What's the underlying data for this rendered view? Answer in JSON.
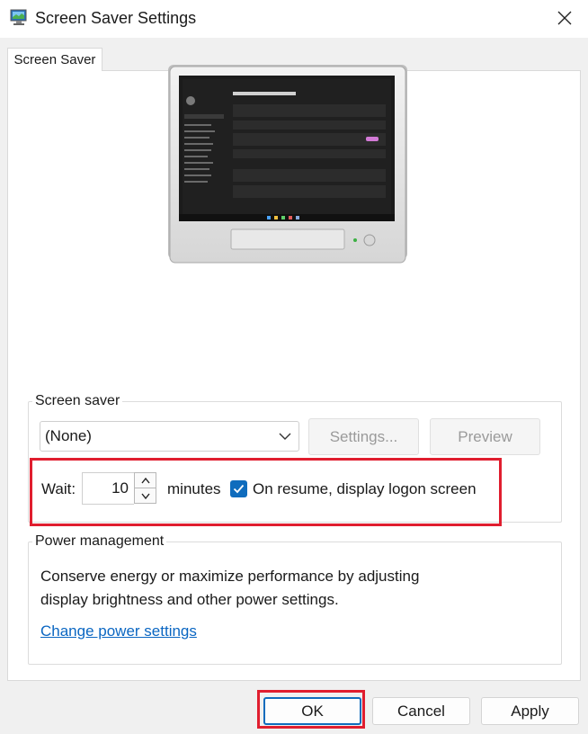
{
  "window": {
    "title": "Screen Saver Settings",
    "app_icon": "monitor-icon",
    "close_icon": "close-icon"
  },
  "tabs": [
    {
      "label": "Screen Saver"
    }
  ],
  "screen_saver": {
    "group_label": "Screen saver",
    "selected": "(None)",
    "settings_label": "Settings...",
    "preview_label": "Preview",
    "wait_label": "Wait:",
    "wait_value": "10",
    "minutes_label": "minutes",
    "resume_checkbox_label": "On resume, display logon screen",
    "resume_checked": true
  },
  "power": {
    "group_label": "Power management",
    "description_line1": "Conserve energy or maximize performance by adjusting",
    "description_line2": "display brightness and other power settings.",
    "link_label": "Change power settings"
  },
  "footer": {
    "ok_label": "OK",
    "cancel_label": "Cancel",
    "apply_label": "Apply"
  },
  "colors": {
    "accent": "#0f6cbd",
    "highlight": "#e01e2f",
    "link": "#0a66c2"
  }
}
